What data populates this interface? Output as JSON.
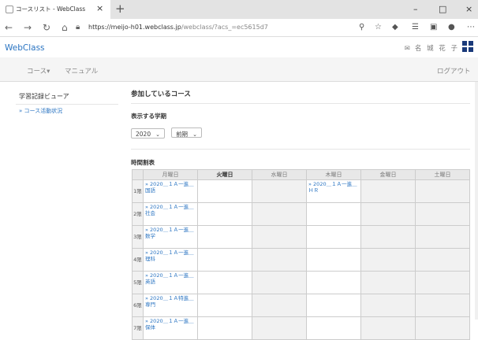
{
  "browser": {
    "tab_title": "コースリスト - WebClass",
    "tab_close": "×",
    "new_tab": "+",
    "url_main": "https://meijo-h01.webclass.jp",
    "url_rest": "/webclass/?acs_=ec5615d7",
    "win_min": "–",
    "win_max": "□",
    "win_close": "×"
  },
  "site": {
    "brand": "WebClass",
    "user_name": "名 城 花 子",
    "menu_course": "コース▾",
    "menu_manual": "マニュアル",
    "logout": "ログアウト"
  },
  "sidebar": {
    "title": "学習記録ビューア",
    "link": "» コース活動状況"
  },
  "main": {
    "section_title": "参加しているコース",
    "term_label": "表示する学期",
    "year_value": "2020",
    "term_value": "前期",
    "timetable_title": "時間割表",
    "days": [
      "月曜日",
      "火曜日",
      "水曜日",
      "木曜日",
      "金曜日",
      "土曜日"
    ],
    "periods": [
      {
        "label": "1限",
        "mon": "» 2020＿１Ａ一進＿国語",
        "thu": "» 2020＿１Ａ一進＿ＨＲ"
      },
      {
        "label": "2限",
        "mon": "» 2020＿１Ａ一進＿社会",
        "thu": ""
      },
      {
        "label": "3限",
        "mon": "» 2020＿１Ａ一進＿数学",
        "thu": ""
      },
      {
        "label": "4限",
        "mon": "» 2020＿１Ａ一進＿理科",
        "thu": ""
      },
      {
        "label": "5限",
        "mon": "» 2020＿１Ａ一進＿英語",
        "thu": ""
      },
      {
        "label": "6限",
        "mon": "» 2020＿１Ａ特進＿専門",
        "thu": ""
      },
      {
        "label": "7限",
        "mon": "» 2020＿１Ａ一進＿保体",
        "thu": ""
      }
    ]
  }
}
